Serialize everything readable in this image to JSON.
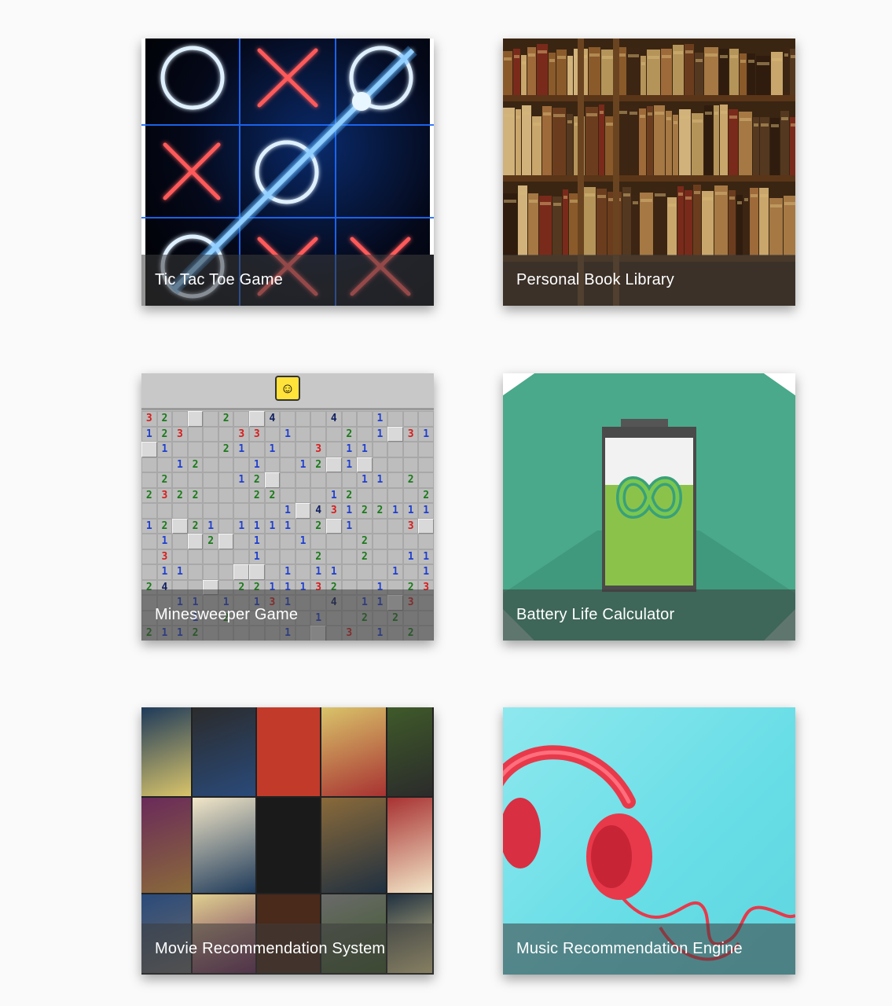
{
  "cards": [
    {
      "title": "Tic Tac Toe Game",
      "image": "tic-tac-toe-neon-board"
    },
    {
      "title": "Personal Book Library",
      "image": "bookshelf-photo"
    },
    {
      "title": "Minesweeper Game",
      "image": "minesweeper-board"
    },
    {
      "title": "Battery Life Calculator",
      "image": "battery-infinity-icon"
    },
    {
      "title": "Movie Recommendation System",
      "image": "movie-poster-collage"
    },
    {
      "title": "Music Recommendation Engine",
      "image": "red-headphones-photo"
    }
  ],
  "colors": {
    "caption_overlay": "rgba(60,60,60,0.55)",
    "battery_green": "#4aa98a",
    "headphones_red": "#e8394a",
    "music_bg": "#67dde6"
  }
}
